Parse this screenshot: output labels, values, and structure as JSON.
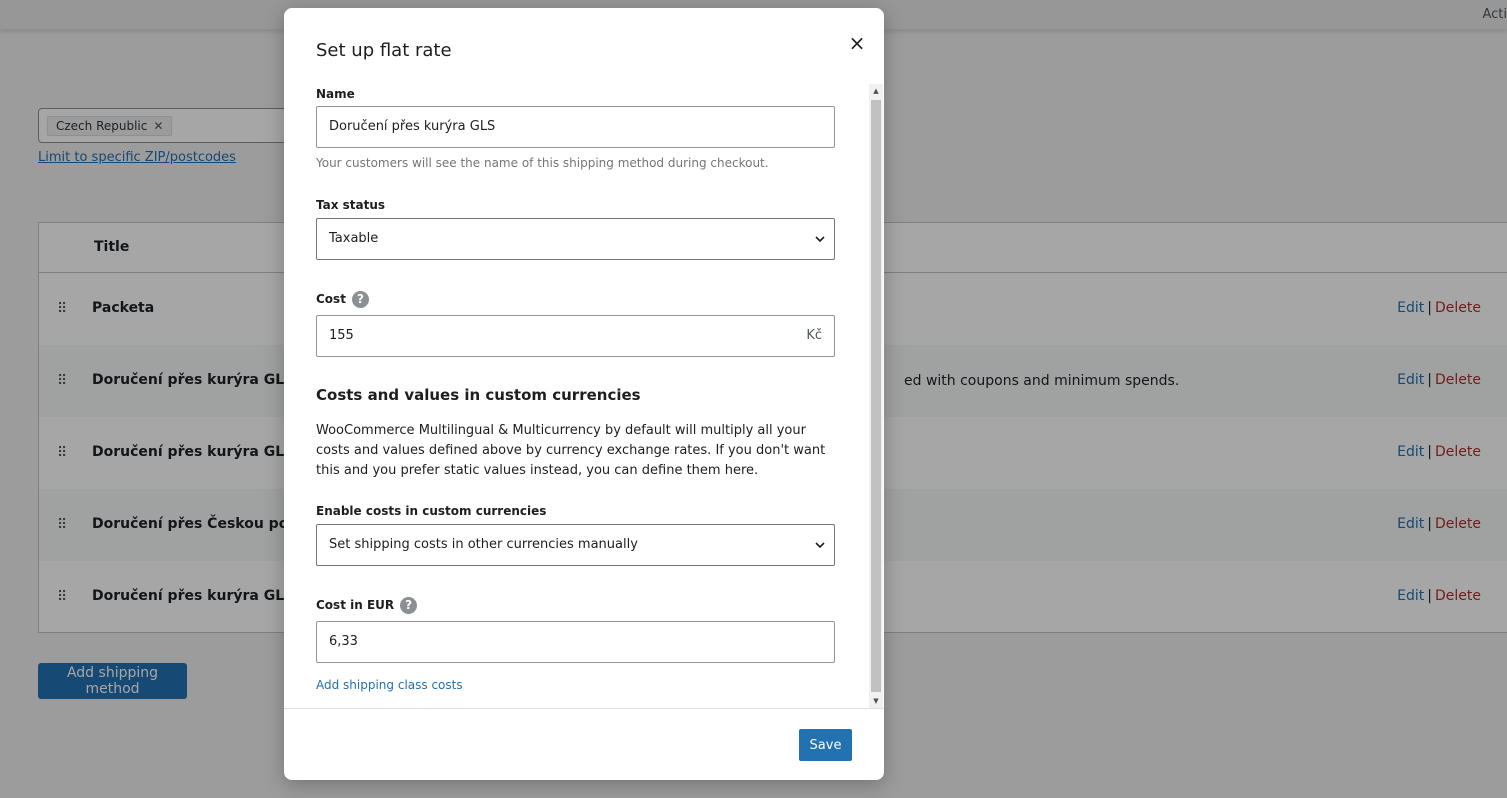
{
  "topbar": {
    "right_text": "Acti"
  },
  "region": {
    "chip_label": "Czech Republic",
    "chip_remove": "✕"
  },
  "limit_link": "Limit to specific ZIP/postcodes",
  "table": {
    "header_title": "Title",
    "rows": [
      {
        "title": "Packeta",
        "desc": ""
      },
      {
        "title": "Doručení přes kurýra GLS zdar",
        "desc": "ed with coupons and minimum spends."
      },
      {
        "title": "Doručení přes kurýra GLS",
        "desc": ""
      },
      {
        "title": "Doručení přes Českou poštu",
        "desc": ""
      },
      {
        "title": "Doručení přes kurýra GLS",
        "desc": ""
      }
    ],
    "edit_label": "Edit",
    "separator": "|",
    "delete_label": "Delete"
  },
  "add_method_button": "Add shipping method",
  "modal": {
    "title": "Set up flat rate",
    "close": "×",
    "name_label": "Name",
    "name_value": "Doručení přes kurýra GLS",
    "name_hint": "Your customers will see the name of this shipping method during checkout.",
    "tax_label": "Tax status",
    "tax_value": "Taxable",
    "cost_label": "Cost",
    "help": "?",
    "cost_value": "155",
    "cost_suffix": "Kč",
    "custom_title": "Costs and values in custom currencies",
    "custom_para": "WooCommerce Multilingual & Multicurrency by default will multiply all your costs and values defined above by currency exchange rates. If you don't want this and you prefer static values instead, you can define them here.",
    "enable_label": "Enable costs in custom currencies",
    "enable_value": "Set shipping costs in other currencies manually",
    "eur_label": "Cost in EUR",
    "eur_value": "6,33",
    "class_costs_link": "Add shipping class costs",
    "save": "Save"
  },
  "colors": {
    "accent": "#2271b1",
    "danger": "#b32d2e"
  }
}
